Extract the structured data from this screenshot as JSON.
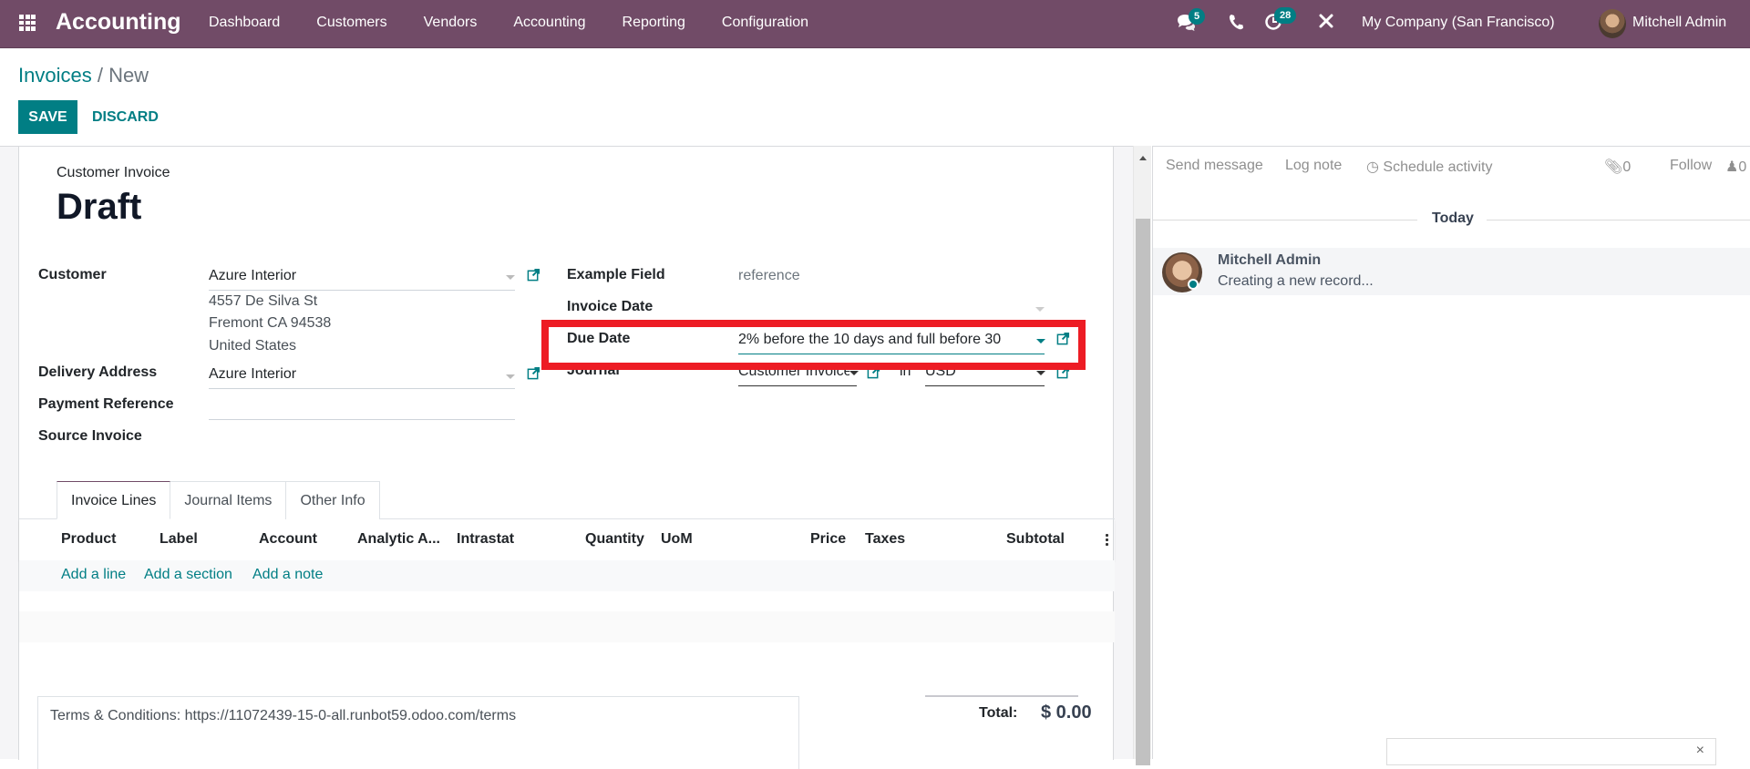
{
  "navbar": {
    "app_name": "Accounting",
    "menu": [
      "Dashboard",
      "Customers",
      "Vendors",
      "Accounting",
      "Reporting",
      "Configuration"
    ],
    "messages_count": "5",
    "activities_count": "28",
    "company": "My Company (San Francisco)",
    "user": "Mitchell Admin",
    "colors": {
      "brand": "#714B67",
      "accent": "#017e84"
    }
  },
  "control_panel": {
    "breadcrumb_parent": "Invoices",
    "breadcrumb_sep": " / ",
    "breadcrumb_current": "New",
    "save_label": "SAVE",
    "discard_label": "DISCARD"
  },
  "form": {
    "subtitle": "Customer Invoice",
    "title": "Draft",
    "left": {
      "customer_label": "Customer",
      "customer_value": "Azure Interior",
      "address_lines": [
        "4557 De Silva St",
        "Fremont CA 94538",
        "United States"
      ],
      "delivery_label": "Delivery Address",
      "delivery_value": "Azure Interior",
      "payment_ref_label": "Payment Reference",
      "payment_ref_value": "",
      "source_invoice_label": "Source Invoice"
    },
    "right": {
      "example_label": "Example Field",
      "example_value": "reference",
      "invoice_date_label": "Invoice Date",
      "invoice_date_value": "",
      "due_date_label": "Due Date",
      "due_date_value": "2% before the 10 days and full before 30",
      "journal_label": "Journal",
      "journal_value": "Customer Invoices",
      "in_label": "in",
      "currency_value": "USD"
    },
    "tabs": [
      "Invoice Lines",
      "Journal Items",
      "Other Info"
    ],
    "active_tab": "Invoice Lines",
    "columns": [
      "Product",
      "Label",
      "Account",
      "Analytic A...",
      "Intrastat",
      "Quantity",
      "UoM",
      "Price",
      "Taxes",
      "Subtotal"
    ],
    "add_links": [
      "Add a line",
      "Add a section",
      "Add a note"
    ],
    "terms": "Terms & Conditions: https://11072439-15-0-all.runbot59.odoo.com/terms",
    "total_label": "Total:",
    "total_value": "$ 0.00"
  },
  "chatter": {
    "send_message": "Send message",
    "log_note": "Log note",
    "schedule_activity": "Schedule activity",
    "attachments_count": "0",
    "follow": "Follow",
    "followers_count": "0",
    "date_separator": "Today",
    "messages": [
      {
        "author": "Mitchell Admin",
        "body": "Creating a new record..."
      }
    ]
  },
  "toast": {
    "close": "×"
  }
}
